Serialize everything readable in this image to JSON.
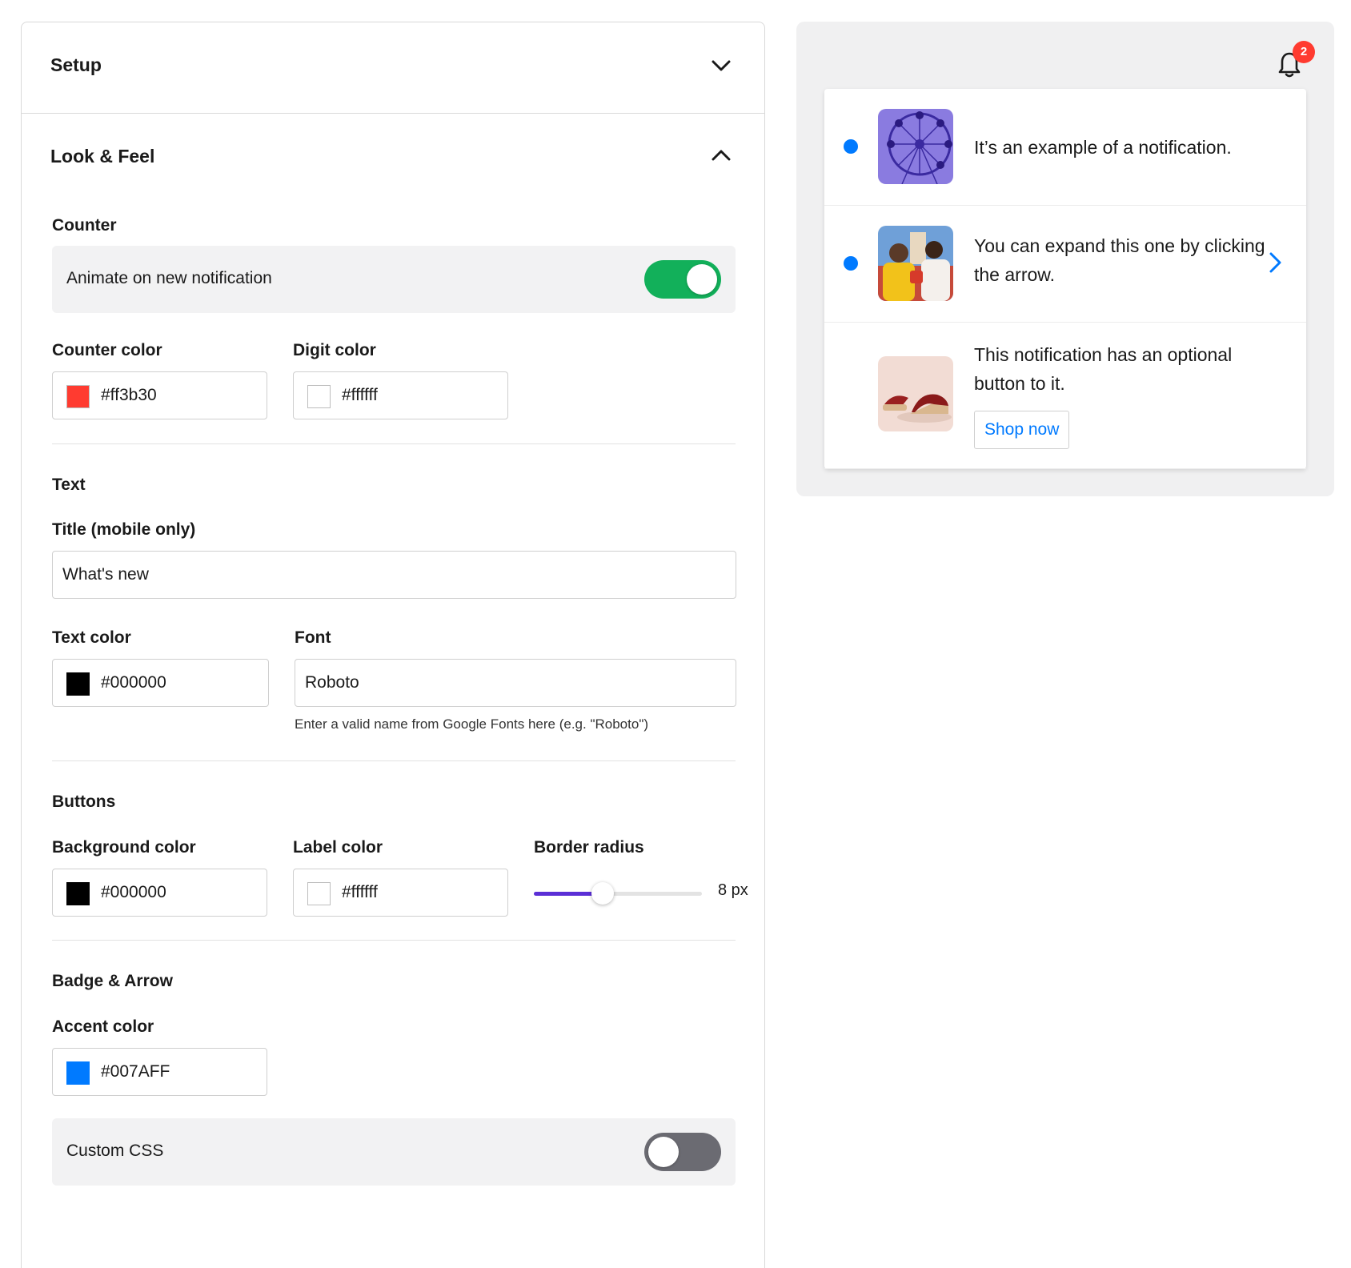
{
  "colors": {
    "accent": "#007aff",
    "toggle_on": "#12b05a",
    "toggle_off": "#6b6b72",
    "badge": "#ff3b30",
    "slider": "#5b2fd6"
  },
  "setup": {
    "title": "Setup",
    "icon": "chevron-down-icon"
  },
  "look_feel": {
    "title": "Look & Feel",
    "icon": "chevron-up-icon",
    "counter": {
      "section": "Counter",
      "animate_label": "Animate on new notification",
      "animate_on": true,
      "counter_color_label": "Counter color",
      "counter_color_value": "#ff3b30",
      "digit_color_label": "Digit color",
      "digit_color_value": "#ffffff"
    },
    "text": {
      "section": "Text",
      "title_label": "Title (mobile only)",
      "title_value": "What's new",
      "text_color_label": "Text color",
      "text_color_value": "#000000",
      "font_label": "Font",
      "font_value": "Roboto",
      "font_help": "Enter a valid name from Google Fonts here (e.g. \"Roboto\")"
    },
    "buttons": {
      "section": "Buttons",
      "bg_color_label": "Background color",
      "bg_color_value": "#000000",
      "label_color_label": "Label color",
      "label_color_value": "#ffffff",
      "radius_label": "Border radius",
      "radius_value": "8 px",
      "radius_fraction": 0.41
    },
    "badge_arrow": {
      "section": "Badge & Arrow",
      "accent_label": "Accent color",
      "accent_value": "#007AFF"
    },
    "custom_css": {
      "label": "Custom CSS",
      "on": false
    }
  },
  "preview": {
    "badge_count": "2",
    "notifications": [
      {
        "text": "It’s an example of a notification.",
        "unread": true,
        "image": "ferris-wheel-image"
      },
      {
        "text": "You can expand this one by clicking the arrow.",
        "unread": true,
        "image": "people-image",
        "expandable": true
      },
      {
        "text": "This notification has an optional button to it.",
        "unread": false,
        "image": "shoe-image",
        "button": "Shop now"
      }
    ]
  }
}
